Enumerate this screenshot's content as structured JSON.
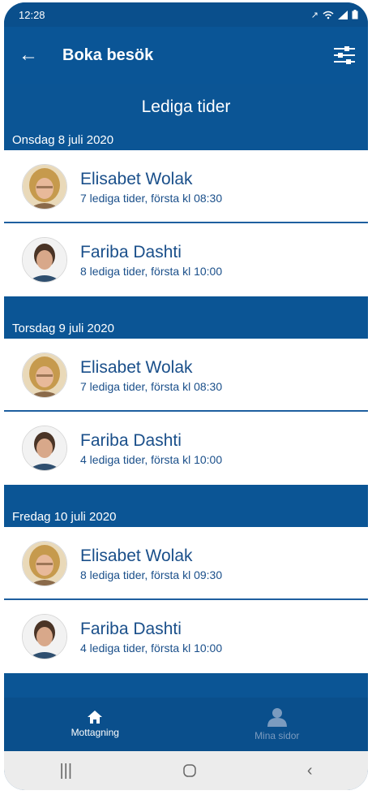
{
  "status": {
    "time": "12:28"
  },
  "appbar": {
    "title": "Boka besök"
  },
  "section": {
    "title": "Lediga tider"
  },
  "days": [
    {
      "date": "Onsdag 8 juli 2020",
      "entries": [
        {
          "name": "Elisabet Wolak",
          "info": "7 lediga tider, första kl 08:30"
        },
        {
          "name": "Fariba Dashti",
          "info": "8 lediga tider, första kl 10:00"
        }
      ]
    },
    {
      "date": "Torsdag 9 juli 2020",
      "entries": [
        {
          "name": "Elisabet Wolak",
          "info": "7 lediga tider, första kl 08:30"
        },
        {
          "name": "Fariba Dashti",
          "info": "4 lediga tider, första kl 10:00"
        }
      ]
    },
    {
      "date": "Fredag 10 juli 2020",
      "entries": [
        {
          "name": "Elisabet Wolak",
          "info": "8 lediga tider, första kl 09:30"
        },
        {
          "name": "Fariba Dashti",
          "info": "4 lediga tider, första kl 10:00"
        }
      ]
    }
  ],
  "nav": {
    "items": [
      {
        "label": "Mottagning",
        "icon": "home-icon",
        "active": true
      },
      {
        "label": "Mina sidor",
        "icon": "person-icon",
        "active": false
      }
    ]
  },
  "colors": {
    "primary": "#0b5595",
    "text_blue": "#1a4f8a"
  }
}
